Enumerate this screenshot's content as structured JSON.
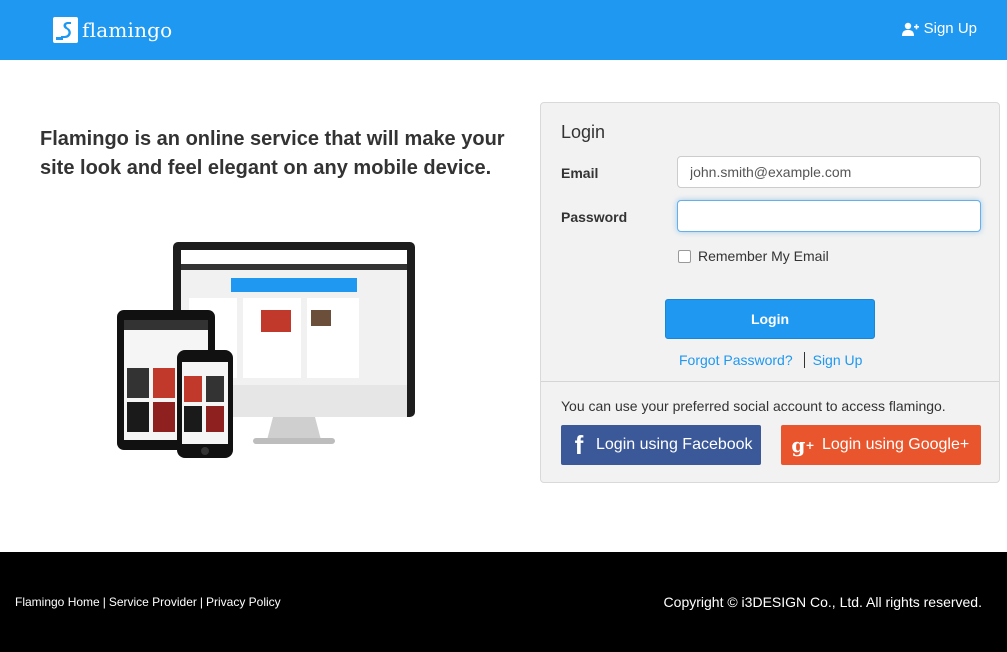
{
  "header": {
    "brand": "flamingo",
    "signup_label": "Sign Up"
  },
  "hero": {
    "tagline": "Flamingo is an online service that will make your site look and feel elegant on any mobile device."
  },
  "login": {
    "title": "Login",
    "email_label": "Email",
    "email_value": "john.smith@example.com",
    "password_label": "Password",
    "password_value": "",
    "remember_label": "Remember My Email",
    "remember_checked": false,
    "submit_label": "Login",
    "forgot_label": "Forgot Password?",
    "signup_label": "Sign Up",
    "social_note": "You can use your preferred social account to access flamingo.",
    "facebook_label": "Login using Facebook",
    "google_label": "Login using Google+"
  },
  "footer": {
    "links": [
      "Flamingo Home",
      "Service Provider",
      "Privacy Policy"
    ],
    "separator": "|",
    "copyright": "Copyright © i3DESIGN Co., Ltd. All rights reserved."
  },
  "colors": {
    "accent": "#1e98f0",
    "facebook": "#3b5998",
    "google": "#e9562d",
    "footer_bg": "#000000"
  },
  "icons": {
    "brand": "flamingo-logo-icon",
    "signup": "add-user-icon",
    "facebook": "facebook-icon",
    "google": "google-plus-icon"
  }
}
